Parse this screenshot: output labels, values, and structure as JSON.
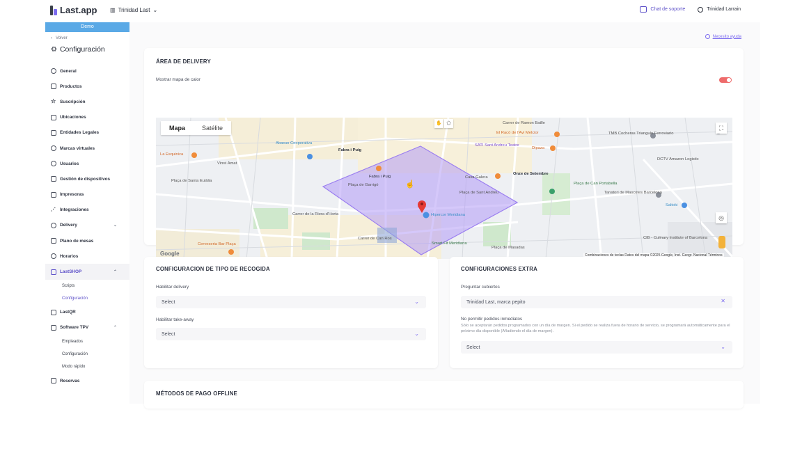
{
  "app": {
    "logo": "Last.app"
  },
  "header": {
    "store_name": "Trinidad Last",
    "support_label": "Chat de soporte",
    "user_name": "Trinidad Larrain"
  },
  "sidebar": {
    "demo_badge": "Demo",
    "back_label": "Volver",
    "title": "Configuración",
    "items": [
      {
        "label": "General",
        "icon": "gear-icon"
      },
      {
        "label": "Productos",
        "icon": "grid-icon"
      },
      {
        "label": "Suscripción",
        "icon": "star-icon"
      },
      {
        "label": "Ubicaciones",
        "icon": "store-icon"
      },
      {
        "label": "Entidades Legales",
        "icon": "document-icon"
      },
      {
        "label": "Marcas virtuales",
        "icon": "tag-icon"
      },
      {
        "label": "Usuarios",
        "icon": "user-icon"
      },
      {
        "label": "Gestión de dispositivos",
        "icon": "device-icon"
      },
      {
        "label": "Impresoras",
        "icon": "printer-icon"
      },
      {
        "label": "Integraciones",
        "icon": "plug-icon"
      },
      {
        "label": "Delivery",
        "icon": "moto-icon"
      },
      {
        "label": "Plano de mesas",
        "icon": "table-icon"
      },
      {
        "label": "Horarios",
        "icon": "clock-icon"
      },
      {
        "label": "LastSHOP",
        "icon": "shop-icon"
      },
      {
        "label": "LastQR",
        "icon": "qr-icon"
      },
      {
        "label": "Software TPV",
        "icon": "monitor-icon"
      },
      {
        "label": "Reservas",
        "icon": "calendar-icon"
      }
    ],
    "lastshop_sub": [
      "Scripts",
      "Configuración"
    ],
    "tpv_sub": [
      "Empleados",
      "Configuración",
      "Modo rápido"
    ]
  },
  "main": {
    "help_link": "Necesito ayuda",
    "delivery_area": {
      "title": "ÁREA DE DELIVERY",
      "heatmap_label": "Mostrar mapa de calor",
      "heatmap_enabled": true,
      "map_tabs": [
        "Mapa",
        "Satélite"
      ],
      "map_attribution": "Combinaciones de teclas   Datos del mapa ©2025 Google, Inst. Geogr. Nacional   Términos",
      "map_places": [
        "Abacus Cooperativa",
        "Fabra i Puig",
        "Carrer de Ramon Batlle",
        "El Racó de l'Avi Melcior",
        "SATI Sant Andreu Teatre",
        "TMB Cocheras Triangulo Ferroviario",
        "DCTV Amazon Logistic",
        "La Esquinica",
        "Virrei Amat",
        "Plaça de Santa Eulàlia",
        "Fabra i Puig",
        "Onze de Setembre",
        "Plaça de Can Portabella",
        "Tanatori de Mascotes Barcelona",
        "Saltoki",
        "Plaça de Garrigó",
        "Plaça de Sant Andreu",
        "Hipercor Meridiana",
        "Carrer de la Riera d'Horta",
        "Cerveseria Bar Plaça",
        "Carrer de Can Ros",
        "Smart Fit Meridiana",
        "Plaça de Masadas",
        "CIB - Culinary Institute of Barcelona",
        "Casa Galera",
        "Dipaza"
      ]
    },
    "pickup": {
      "title": "CONFIGURACION DE TIPO DE RECOGIDA",
      "delivery_label": "Habilitar delivery",
      "delivery_value": "Select",
      "takeaway_label": "Habilitar take-away",
      "takeaway_value": "Select"
    },
    "extra": {
      "title": "CONFIGURACIONES EXTRA",
      "cutlery_label": "Preguntar cubiertos",
      "cutlery_value": "Trinidad Last, marca pepito",
      "immediate_label": "No permitir pedidos inmediatos",
      "immediate_help": "Sólo se aceptarán pedidos programados con un día de margen. Si el pedido se realiza fuera de horario de servicio, se programará automáticamente para el próximo día disponible (Añadiendo el día de margen).",
      "immediate_value": "Select"
    },
    "payment": {
      "title": "MÉTODOS DE PAGO OFFLINE"
    }
  },
  "colors": {
    "accent": "#7c6cf0",
    "toggle_on": "#ee6b6b",
    "demo": "#5aa9e6",
    "polygon": "#a78bfa"
  }
}
